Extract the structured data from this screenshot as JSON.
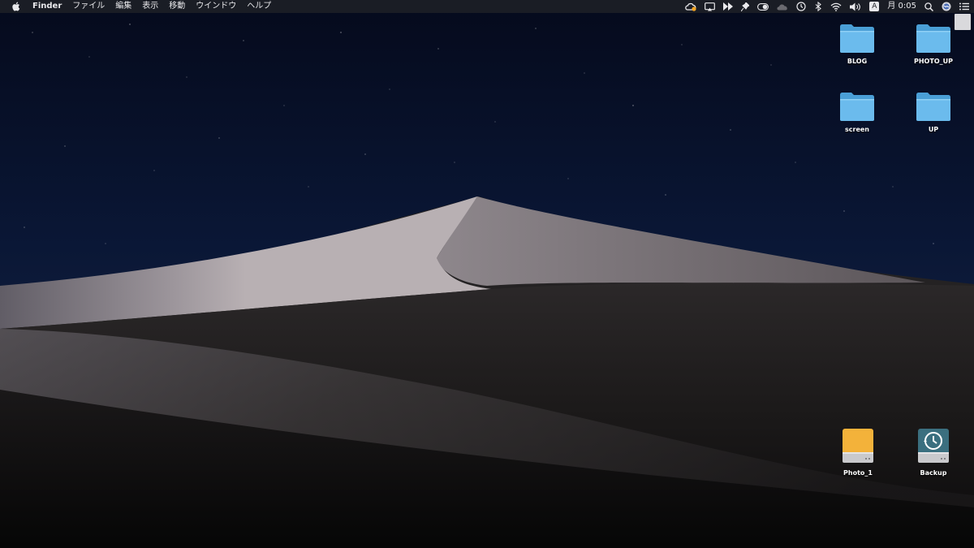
{
  "menubar": {
    "app_name": "Finder",
    "menus": [
      "ファイル",
      "編集",
      "表示",
      "移動",
      "ウインドウ",
      "ヘルプ"
    ],
    "status_icons": [
      "creative-cloud-icon",
      "screen-mirroring-icon",
      "fast-forward-icon",
      "pin-icon",
      "toggle-icon",
      "cloud-icon",
      "time-machine-icon",
      "bluetooth-icon",
      "wifi-icon",
      "volume-icon",
      "input-source-icon",
      "spotlight-icon",
      "siri-icon",
      "notification-center-icon"
    ],
    "input_source": "A",
    "clock": "月 0:05"
  },
  "desktop": {
    "folders": [
      {
        "label": "BLOG",
        "icon": "folder-icon"
      },
      {
        "label": "PHOTO_UP",
        "icon": "folder-icon"
      },
      {
        "label": "screen",
        "icon": "folder-icon"
      },
      {
        "label": "UP",
        "icon": "folder-icon"
      }
    ],
    "drives": [
      {
        "label": "Photo_1",
        "icon": "external-drive-icon"
      },
      {
        "label": "Backup",
        "icon": "time-machine-drive-icon"
      }
    ]
  },
  "colors": {
    "folder": "#5aaee3",
    "drive_orange": "#f3b23a",
    "drive_teal": "#3b6f7f",
    "sky": "#081433"
  }
}
